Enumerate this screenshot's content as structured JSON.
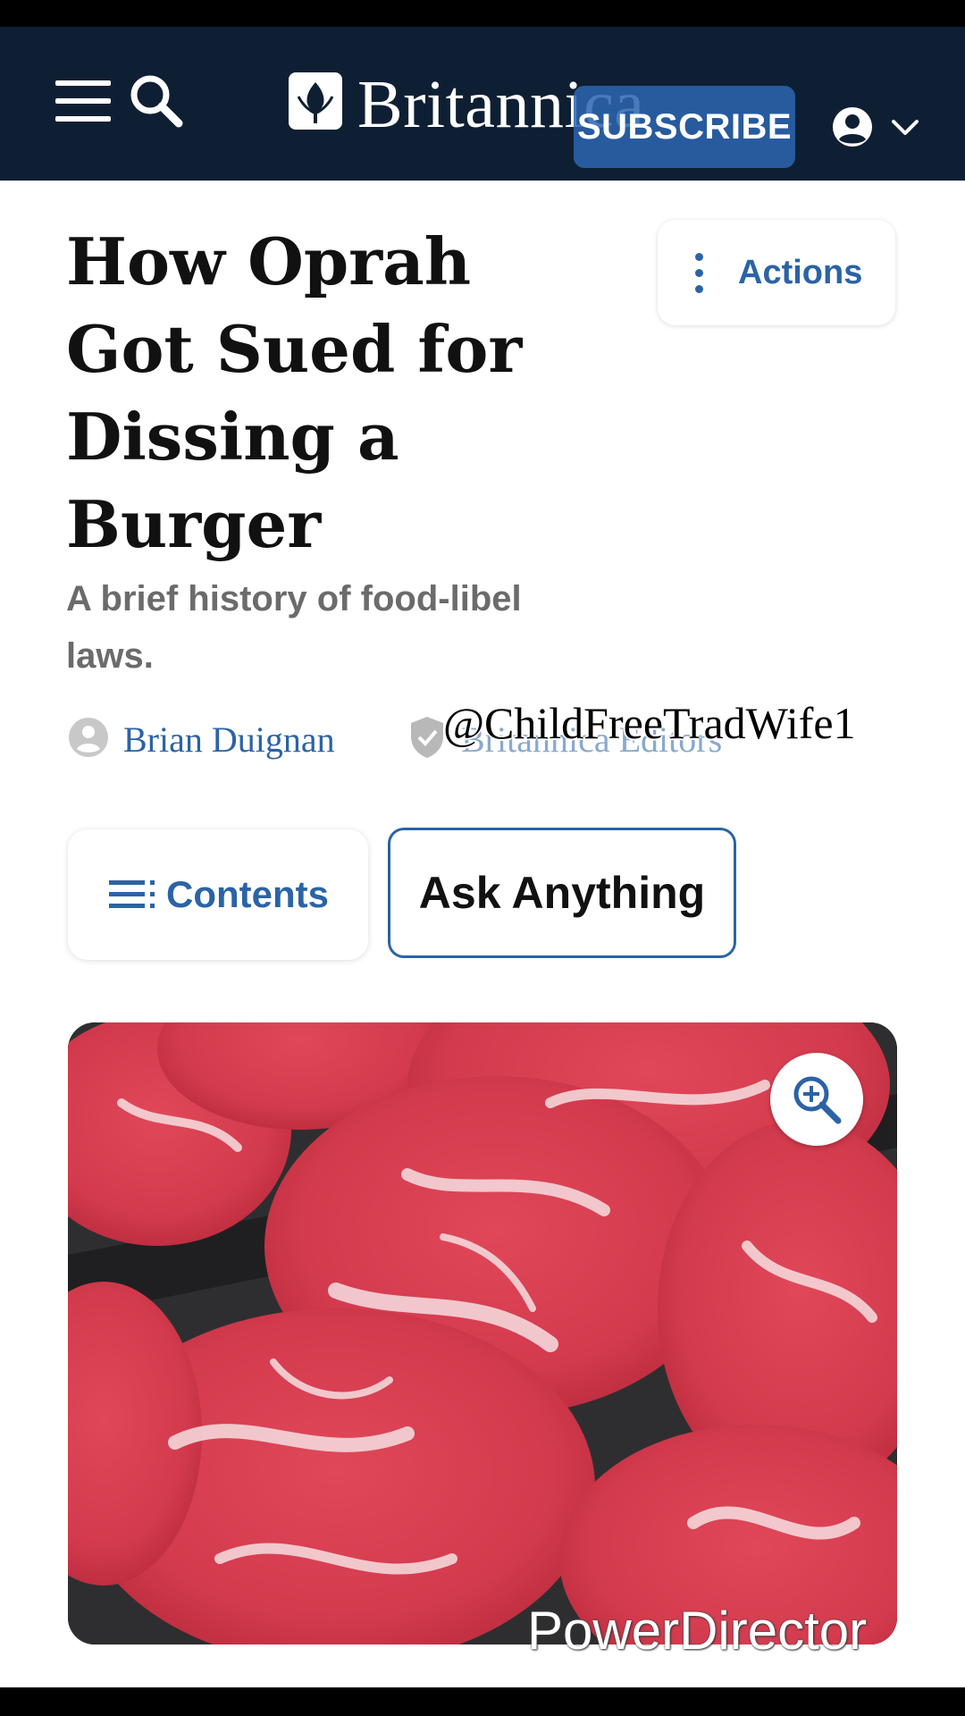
{
  "header": {
    "brand_name": "Britannica",
    "subscribe_label": "SUBSCRIBE"
  },
  "article": {
    "title": "How Oprah Got Sued for Dissing a Burger",
    "subtitle": "A brief history of food-libel laws.",
    "actions_label": "Actions",
    "author": "Brian Duignan",
    "editors": "Britannica Editors",
    "contents_label": "Contents",
    "ask_label": "Ask Anything"
  },
  "overlays": {
    "handle": "@ChildFreeTradWife1",
    "editor_watermark": "PowerDirector"
  },
  "icons": [
    "menu-icon",
    "search-icon",
    "britannica-logo-icon",
    "account-icon",
    "chevron-down-icon",
    "kebab-icon",
    "person-icon",
    "shield-check-icon",
    "list-icon",
    "zoom-in-icon"
  ],
  "colors": {
    "header_bg": "#0f1f33",
    "accent_blue": "#2b63a6",
    "subscribe_bg": "#2b65b0",
    "subtitle_gray": "#6b6b6b"
  }
}
